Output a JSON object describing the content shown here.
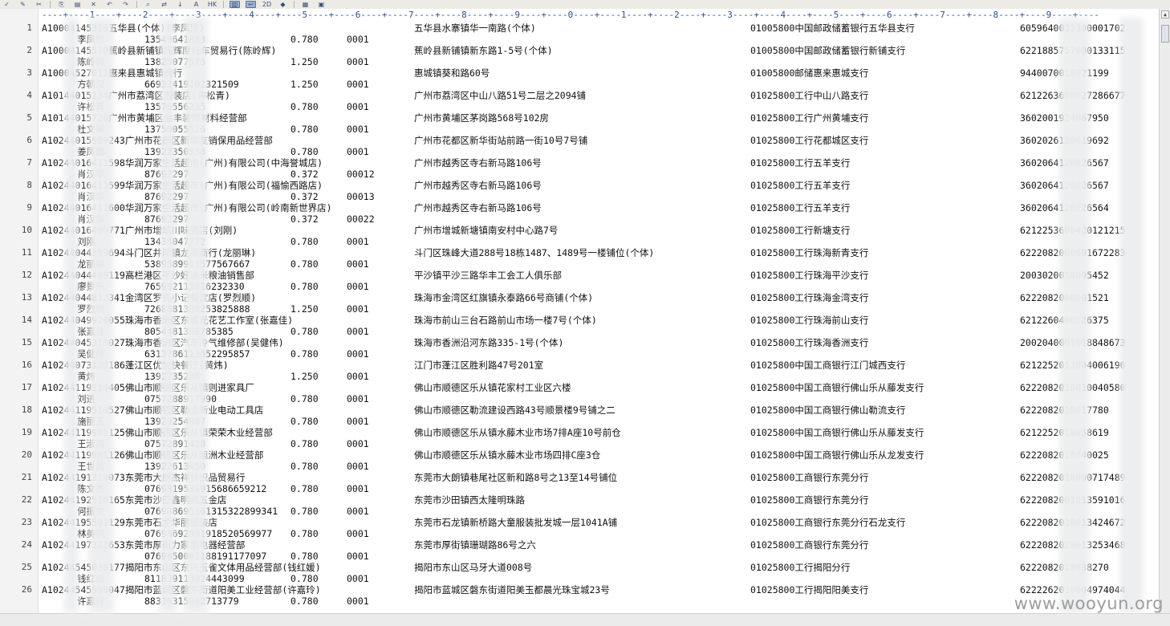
{
  "toolbar": {
    "icons": [
      "check-icon",
      "edit-icon",
      "cut-icon",
      "copy-icon",
      "paste-icon",
      "delete-icon",
      "undo-icon",
      "redo-icon",
      "search-icon",
      "replace-icon",
      "find-next-icon",
      "font-icon",
      "hex-icon",
      "column-mode-icon",
      "wrap-icon",
      "zoom-icon",
      "highlight-icon",
      "print-icon",
      "settings-icon"
    ],
    "labels": [
      "✓",
      "✎",
      "✂",
      "⎘",
      "▤",
      "✕",
      "↶",
      "↷",
      "⌕",
      "⇄",
      "↓",
      "A",
      "HK",
      "▥",
      "↩",
      "2D",
      "◆",
      "▦",
      "▣"
    ]
  },
  "ruler": "----+----1----+----2----+----3----+----4----+----5----+----6----+----7----+----8----+----9----+----0----+----1----+----2----+----3----+----4----+----5----+----6----+----7----+----8----+----9----+----",
  "rows": [
    {
      "line": "1",
      "name": "A10004145316五华县(个体)(李凤珍)",
      "contact": "李凤珍",
      "phone": "13549641883",
      "rate": "0.780",
      "code": "0001",
      "address": "五华县水寨镇华一南路(个体)",
      "bank": "01005800中国邮政储蓄银行五华县支行",
      "account": "6059640012300001702"
    },
    {
      "line": "2",
      "name": "A10004145570蕉岭县新铺镇陈辉摩托车贸易行(陈岭辉)",
      "contact": "陈岭辉",
      "phone": "13825077575",
      "rate": "1.250",
      "code": "0001",
      "address": "蕉岭县新铺镇新东路1-5号(个体)",
      "bank": "01005800中国邮政储蓄银行新铺支行",
      "account": "6221885757000133115"
    },
    {
      "line": "3",
      "name": "A10004527011惠来县惠城镇商行",
      "contact": "方朝汉",
      "phone": "66932419102321509",
      "rate": "1.250",
      "code": "0001",
      "address": "惠城镇葵和路60号",
      "bank": "01005800邮储惠来惠城支行",
      "account": "9440070010021199"
    },
    {
      "line": "4",
      "name": "A10144015134广州市荔湾区服装店(许松青)",
      "contact": "许松青",
      "phone": "13576556235",
      "rate": "0.780",
      "code": "0001",
      "address": "广州市荔湾区中山八路51号二层之2094铺",
      "bank": "01025800工行中山八路支行",
      "account": "6212263600027286677"
    },
    {
      "line": "5",
      "name": "A10144015726广州市黄埔区金丰装饰材料经营部",
      "contact": "杜文琴",
      "phone": "13750055526",
      "rate": "0.780",
      "code": "0001",
      "address": "广州市黄埔区茅岗路568号102房",
      "bank": "01025800工行广州黄埔支行",
      "account": "3602001924067950"
    },
    {
      "line": "6",
      "name": "A10244015999243广州市花都区新华友销保用品经营部",
      "contact": "姜凤霞",
      "phone": "13922350838",
      "rate": "0.780",
      "code": "0001",
      "address": "广州市花都区新华街站前路一街10号7号铺",
      "bank": "01025800工行花都城区支行",
      "account": "3602026120019692"
    },
    {
      "line": "7",
      "name": "A10244016411598华润万家生活超市(广州)有限公司(中海誉城店)",
      "contact": "肖汉华",
      "phone": "87692297",
      "rate": "0.372",
      "code": "00012",
      "address": "广州市越秀区寺右新马路106号",
      "bank": "01025800工行五羊支行",
      "account": "3602064120026567"
    },
    {
      "line": "8",
      "name": "A10244016411599华润万家生活超市(广州)有限公司(福愉西路店)",
      "contact": "肖汉华",
      "phone": "87692297",
      "rate": "0.372",
      "code": "00013",
      "address": "广州市越秀区寺右新马路106号",
      "bank": "01025800工行五羊支行",
      "account": "3602064120026567"
    },
    {
      "line": "9",
      "name": "A10244016411600华润万家生活超市(广州)有限公司(岭南新世界店)",
      "contact": "肖汉华",
      "phone": "87692297",
      "rate": "0.372",
      "code": "00022",
      "address": "广州市越秀区寺右新马路106号",
      "bank": "01025800工行五羊支行",
      "account": "3602064120026564"
    },
    {
      "line": "10",
      "name": "A10244016499771广州市增城川味酒店(刘刚)",
      "contact": "刘刚",
      "phone": "13434047272",
      "rate": "0.780",
      "code": "0001",
      "address": "广州市增城新塘镇南安村中心路7号",
      "bank": "01025800工行新塘支行",
      "account": "6212253600420121215"
    },
    {
      "line": "11",
      "name": "A10244044399694斗门区井岸镇龙阁商行(龙丽琳)",
      "contact": "龙丽琳",
      "phone": "5389889913577567667",
      "rate": "0.780",
      "code": "0001",
      "address": "斗门区珠峰大道288号18栋1487、1489号一楼铺位(个体)",
      "bank": "01025800工行珠海新青支行",
      "account": "6222082000001672283"
    },
    {
      "line": "12",
      "name": "A10244044499119高栏港区平沙好油米粮油销售部",
      "contact": "廖景乐",
      "phone": "765902113016232330",
      "rate": "0.780",
      "code": "0001",
      "address": "平沙镇平沙三路华丰工会工人俱乐部",
      "bank": "01025800工行珠海平沙支行",
      "account": "2003020010005452"
    },
    {
      "line": "13",
      "name": "A10244044812341金湾区罗氏小记餐饮店(罗烈顺)",
      "contact": "罗烈顺",
      "phone": "7268881380253825888",
      "rate": "1.250",
      "code": "0001",
      "address": "珠海市金湾区红旗镇永泰路66号商铺(个体)",
      "bank": "01025800工行珠海金湾支行",
      "account": "6222082000001521"
    },
    {
      "line": "14",
      "name": "A10244049920055珠海市香洲区东城光花艺工作室(张嘉佳)",
      "contact": "张嘉佳",
      "phone": "8054481366785385",
      "rate": "0.780",
      "code": "0001",
      "address": "珠海市前山三台石路前山市场一楼7号(个体)",
      "bank": "01025800工行珠海前山支行",
      "account": "6212260400026375"
    },
    {
      "line": "15",
      "name": "A10244045310027珠海市香洲区汽车冷气维修部(吴健伟)",
      "contact": "吴健伟",
      "phone": "6313786113652295857",
      "rate": "0.780",
      "code": "0001",
      "address": "珠海市香洲沿河东路335-1号(个体)",
      "bank": "01025800工行珠海香洲支行",
      "account": "2002040001018848673"
    },
    {
      "line": "16",
      "name": "A10244073120186蓬江区优悦快餐厅(黄炜)",
      "contact": "黄炜",
      "phone": "1392735208",
      "rate": "1.250",
      "code": "0001",
      "address": "江门市蓬江区胜利路47号201室",
      "bank": "01025800中国工商银行江门城西支行",
      "account": "6212252012004006190"
    },
    {
      "line": "17",
      "name": "A10244119210405佛山市顺德区乐从镇则进家具厂",
      "contact": "刘进",
      "phone": "0757288917990",
      "rate": "0.780",
      "code": "0001",
      "address": "佛山市顺德区乐从镇花家村工业区六楼",
      "bank": "01025800中国工商银行佛山乐从藤发支行",
      "account": "6222082010010040580"
    },
    {
      "line": "18",
      "name": "A10244119510527佛山市顺德区勒流新业电动工具店",
      "contact": "施丽玉",
      "phone": "13929254087",
      "rate": "0.780",
      "code": "0001",
      "address": "佛山市顺德区勒流建设西路43号顺景楼9号铺之二",
      "bank": "01025800中国工商银行佛山勒流支行",
      "account": "6222082010017780"
    },
    {
      "line": "19",
      "name": "A10244119981125佛山市顺德区乐从镇荣荣木业经营部",
      "contact": "王淑霞",
      "phone": "07572891428",
      "rate": "0.780",
      "code": "0001",
      "address": "佛山市顺德区乐从镇水藤木业市场7排A座10号前仓",
      "bank": "01025800中国工商银行佛山乐从藤发支行",
      "account": "6212252010058619"
    },
    {
      "line": "20",
      "name": "A10244119981126佛山市顺德区乐从旭洲木业经营部",
      "contact": "王世昌",
      "phone": "13922613450",
      "rate": "0.780",
      "code": "0001",
      "address": "佛山市顺德区乐从镇水藤木业市场四排C座3仓",
      "bank": "01025800中国工商银行佛山乐从龙发支行",
      "account": "6222082010040025"
    },
    {
      "line": "21",
      "name": "A10244191310073东莞市大朗杰祥针织品贸易行",
      "contact": "陈文杰",
      "phone": "0769819539915686659212",
      "rate": "0.780",
      "code": "0001",
      "address": "东莞市大朗镇巷尾社区新和路8号之13至14号铺位",
      "bank": "01025800工商银行东莞分行",
      "account": "6222082010000717489"
    },
    {
      "line": "22",
      "name": "A10244192510165东莞市沙田鑫明机五金店",
      "contact": "何振文",
      "phone": "076988695361315322899341",
      "rate": "0.780",
      "code": "0001",
      "address": "东莞市沙田镇西太隆明珠路",
      "bank": "01025800工商银行东莞分行",
      "account": "6222082001013591016"
    },
    {
      "line": "23",
      "name": "A10244195591129东莞市石龙华丽服装店",
      "contact": "林美丽",
      "phone": "07698692991918520569977",
      "rate": "0.780",
      "code": "0001",
      "address": "东莞市石龙镇新桥路大童服装批发城一层1041A铺",
      "bank": "01025800工商银行东莞分行石龙支行",
      "account": "6222082010013424672"
    },
    {
      "line": "24",
      "name": "A10244197321653东莞市厚街力家用电器经营部",
      "contact": "",
      "phone": "0769850001188191177097",
      "rate": "0.780",
      "code": "0001",
      "address": "东莞市厚街镇珊瑚路86号之六",
      "bank": "01025800工商银行东莞分行",
      "account": "6222082020013253468"
    },
    {
      "line": "25",
      "name": "A10244545030177揭阳市东山区东兴玉雀文体用品经营部(钱红媛)",
      "contact": "钱红媛",
      "phone": "811839113924443099",
      "rate": "0.780",
      "code": "0001",
      "address": "揭阳市东山区马牙大道008号",
      "bank": "01025800工行揭阳分行",
      "account": "6222082010038270"
    },
    {
      "line": "26",
      "name": "A10244545998047揭阳市蓝城区磐东街道阳美工业经营部(许嘉玲)",
      "contact": "许嘉玲",
      "phone": "88316315902713779",
      "rate": "0.780",
      "code": "0001",
      "address": "揭阳市蓝城区磐东街道阳美玉都晨光珠宝城23号",
      "bank": "01025800工行揭阳阳美支行",
      "account": "6222262010004974044"
    }
  ],
  "watermark": "www.wooyun.org"
}
